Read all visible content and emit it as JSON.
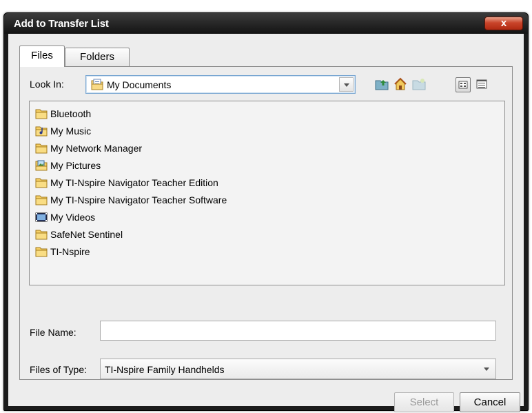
{
  "window": {
    "title": "Add to Transfer List",
    "close_label": "x"
  },
  "tabs": [
    {
      "label": "Files",
      "selected": true
    },
    {
      "label": "Folders",
      "selected": false
    }
  ],
  "look_in": {
    "label": "Look In:",
    "value": "My Documents"
  },
  "toolbar": {
    "icons": [
      "up-folder-icon",
      "home-icon",
      "new-folder-icon",
      "list-view-icon",
      "details-view-icon"
    ]
  },
  "files": [
    {
      "name": "Bluetooth",
      "icon": "folder-icon"
    },
    {
      "name": "My Music",
      "icon": "music-folder-icon"
    },
    {
      "name": "My Network Manager",
      "icon": "folder-icon"
    },
    {
      "name": "My Pictures",
      "icon": "pictures-folder-icon"
    },
    {
      "name": "My TI-Nspire Navigator Teacher Edition",
      "icon": "folder-icon"
    },
    {
      "name": "My TI-Nspire Navigator Teacher Software",
      "icon": "folder-icon"
    },
    {
      "name": "My Videos",
      "icon": "videos-folder-icon"
    },
    {
      "name": "SafeNet Sentinel",
      "icon": "folder-icon"
    },
    {
      "name": "TI-Nspire",
      "icon": "folder-icon"
    }
  ],
  "file_name": {
    "label": "File Name:",
    "value": ""
  },
  "files_of_type": {
    "label": "Files of Type:",
    "value": "TI-Nspire Family Handhelds"
  },
  "buttons": {
    "select": "Select",
    "cancel": "Cancel"
  }
}
